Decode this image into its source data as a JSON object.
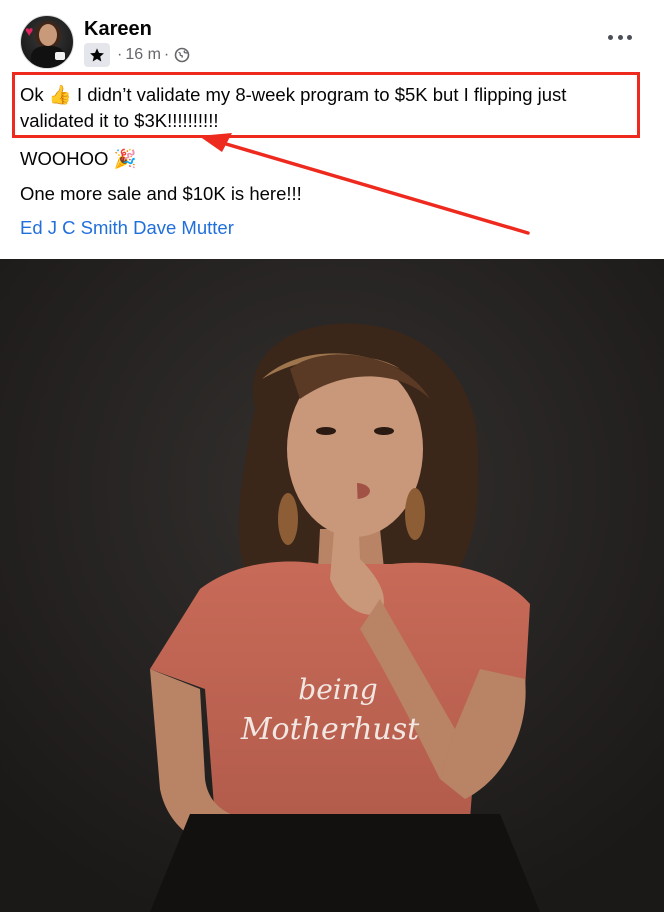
{
  "post": {
    "author": "Kareen",
    "time": "16 m",
    "separator": "·",
    "lines": {
      "line1_a": "Ok ",
      "line1_emoji": "👍",
      "line1_b": " I didn’t validate my 8-week program to $5K but I flipping just",
      "line2": "validated it to $3K!!!!!!!!!!",
      "woohoo": "WOOHOO ",
      "woohoo_emoji": "🎉",
      "line4": "One more sale and $10K is here!!!"
    },
    "tags": [
      "Ed J C Smith",
      "Dave Mutter"
    ]
  },
  "photo": {
    "shirt_text_line1": "being",
    "shirt_text_line2": "Motherhust"
  },
  "colors": {
    "annotation": "#ee2a1f",
    "link": "#216fdb",
    "meta": "#65676b"
  },
  "icons": [
    "star-badge-icon",
    "globe-icon",
    "more-options-icon",
    "heart-icon"
  ]
}
